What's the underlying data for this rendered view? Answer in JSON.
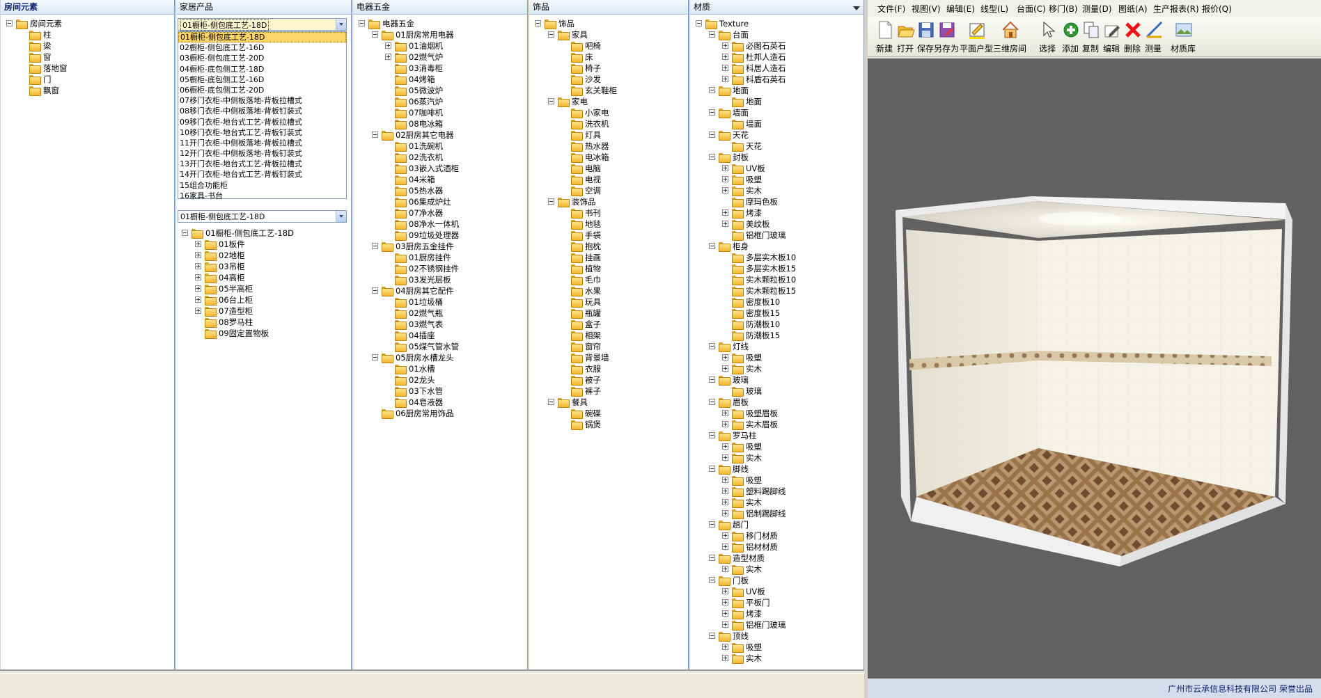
{
  "panels": {
    "room": {
      "title": "房间元素",
      "tree": [
        {
          "label": "房间元素",
          "level": 0,
          "open": true
        },
        {
          "label": "柱",
          "level": 1
        },
        {
          "label": "梁",
          "level": 1
        },
        {
          "label": "窗",
          "level": 1
        },
        {
          "label": "落地窗",
          "level": 1
        },
        {
          "label": "门",
          "level": 1
        },
        {
          "label": "飘窗",
          "level": 1
        }
      ]
    },
    "furniture": {
      "title": "家居产品",
      "dropdown_value": "01橱柜-侧包底工艺-18D",
      "dropdown_options": [
        "01橱柜-侧包底工艺-18D",
        "02橱柜-侧包底工艺-16D",
        "03橱柜-侧包底工艺-20D",
        "04橱柜-底包侧工艺-18D",
        "05橱柜-底包侧工艺-16D",
        "06橱柜-底包侧工艺-20D",
        "07移门衣柜-中侧板落地-背板拉槽式",
        "08移门衣柜-中侧板落地-背板钉装式",
        "09移门衣柜-地台式工艺-背板拉槽式",
        "10移门衣柜-地台式工艺-背板钉装式",
        "11开门衣柜-中侧板落地-背板拉槽式",
        "12开门衣柜-中侧板落地-背板钉装式",
        "13开门衣柜-地台式工艺-背板拉槽式",
        "14开门衣柜-地台式工艺-背板钉装式",
        "15组合功能柜",
        "16家具-书台"
      ],
      "dropdown2_value": "01橱柜-侧包底工艺-18D",
      "tree": [
        {
          "label": "01橱柜-侧包底工艺-18D",
          "level": 0,
          "open": true
        },
        {
          "label": "01板件",
          "level": 1,
          "plus": true
        },
        {
          "label": "02地柜",
          "level": 1,
          "plus": true
        },
        {
          "label": "03吊柜",
          "level": 1,
          "plus": true
        },
        {
          "label": "04高柜",
          "level": 1,
          "plus": true
        },
        {
          "label": "05半高柜",
          "level": 1,
          "plus": true
        },
        {
          "label": "06台上柜",
          "level": 1,
          "plus": true
        },
        {
          "label": "07造型柜",
          "level": 1,
          "plus": true
        },
        {
          "label": "08罗马柱",
          "level": 1
        },
        {
          "label": "09固定置物板",
          "level": 1
        }
      ]
    },
    "appliance": {
      "title": "电器五金",
      "tree": [
        {
          "label": "电器五金",
          "level": 0,
          "open": true
        },
        {
          "label": "01厨房常用电器",
          "level": 1,
          "open": true
        },
        {
          "label": "01油烟机",
          "level": 2,
          "plus": true
        },
        {
          "label": "02燃气炉",
          "level": 2,
          "plus": true
        },
        {
          "label": "03消毒柜",
          "level": 2
        },
        {
          "label": "04烤箱",
          "level": 2
        },
        {
          "label": "05微波炉",
          "level": 2
        },
        {
          "label": "06蒸汽炉",
          "level": 2
        },
        {
          "label": "07咖啡机",
          "level": 2
        },
        {
          "label": "08电冰箱",
          "level": 2
        },
        {
          "label": "02厨房其它电器",
          "level": 1,
          "open": true
        },
        {
          "label": "01洗碗机",
          "level": 2
        },
        {
          "label": "02洗衣机",
          "level": 2
        },
        {
          "label": "03嵌入式酒柜",
          "level": 2
        },
        {
          "label": "04米箱",
          "level": 2
        },
        {
          "label": "05热水器",
          "level": 2
        },
        {
          "label": "06集成炉灶",
          "level": 2
        },
        {
          "label": "07净水器",
          "level": 2
        },
        {
          "label": "08净水一体机",
          "level": 2
        },
        {
          "label": "09垃圾处理器",
          "level": 2
        },
        {
          "label": "03厨房五金挂件",
          "level": 1,
          "open": true
        },
        {
          "label": "01厨房挂件",
          "level": 2
        },
        {
          "label": "02不锈钢挂件",
          "level": 2
        },
        {
          "label": "03发光层板",
          "level": 2
        },
        {
          "label": "04厨房其它配件",
          "level": 1,
          "open": true
        },
        {
          "label": "01垃圾桶",
          "level": 2
        },
        {
          "label": "02燃气瓶",
          "level": 2
        },
        {
          "label": "03燃气表",
          "level": 2
        },
        {
          "label": "04插座",
          "level": 2
        },
        {
          "label": "05煤气管水管",
          "level": 2
        },
        {
          "label": "05厨房水槽龙头",
          "level": 1,
          "open": true
        },
        {
          "label": "01水槽",
          "level": 2
        },
        {
          "label": "02龙头",
          "level": 2
        },
        {
          "label": "03下水管",
          "level": 2
        },
        {
          "label": "04皂液器",
          "level": 2
        },
        {
          "label": "06厨房常用饰品",
          "level": 1
        }
      ]
    },
    "decor": {
      "title": "饰品",
      "tree": [
        {
          "label": "饰品",
          "level": 0,
          "open": true
        },
        {
          "label": "家具",
          "level": 1,
          "open": true
        },
        {
          "label": "吧椅",
          "level": 2
        },
        {
          "label": "床",
          "level": 2
        },
        {
          "label": "椅子",
          "level": 2
        },
        {
          "label": "沙发",
          "level": 2
        },
        {
          "label": "玄关鞋柜",
          "level": 2
        },
        {
          "label": "家电",
          "level": 1,
          "open": true
        },
        {
          "label": "小家电",
          "level": 2
        },
        {
          "label": "洗衣机",
          "level": 2
        },
        {
          "label": "灯具",
          "level": 2
        },
        {
          "label": "热水器",
          "level": 2
        },
        {
          "label": "电冰箱",
          "level": 2
        },
        {
          "label": "电脑",
          "level": 2
        },
        {
          "label": "电视",
          "level": 2
        },
        {
          "label": "空调",
          "level": 2
        },
        {
          "label": "装饰品",
          "level": 1,
          "open": true
        },
        {
          "label": "书刊",
          "level": 2
        },
        {
          "label": "地毯",
          "level": 2
        },
        {
          "label": "手袋",
          "level": 2
        },
        {
          "label": "抱枕",
          "level": 2
        },
        {
          "label": "挂画",
          "level": 2
        },
        {
          "label": "植物",
          "level": 2
        },
        {
          "label": "毛巾",
          "level": 2
        },
        {
          "label": "水果",
          "level": 2
        },
        {
          "label": "玩具",
          "level": 2
        },
        {
          "label": "瓶罐",
          "level": 2
        },
        {
          "label": "盒子",
          "level": 2
        },
        {
          "label": "相架",
          "level": 2
        },
        {
          "label": "窗帘",
          "level": 2
        },
        {
          "label": "背景墙",
          "level": 2
        },
        {
          "label": "衣服",
          "level": 2
        },
        {
          "label": "被子",
          "level": 2
        },
        {
          "label": "裤子",
          "level": 2
        },
        {
          "label": "餐具",
          "level": 1,
          "open": true
        },
        {
          "label": "碗碟",
          "level": 2
        },
        {
          "label": "锅煲",
          "level": 2
        }
      ]
    },
    "material": {
      "title": "材质",
      "tree": [
        {
          "label": "Texture",
          "level": 0,
          "open": true
        },
        {
          "label": "台面",
          "level": 1,
          "open": true
        },
        {
          "label": "必图石英石",
          "level": 2,
          "plus": true
        },
        {
          "label": "杜邦人造石",
          "level": 2,
          "plus": true
        },
        {
          "label": "科居人造石",
          "level": 2,
          "plus": true
        },
        {
          "label": "科盾石英石",
          "level": 2,
          "plus": true
        },
        {
          "label": "地面",
          "level": 1,
          "open": true
        },
        {
          "label": "地面",
          "level": 2
        },
        {
          "label": "墙面",
          "level": 1,
          "open": true
        },
        {
          "label": "墙面",
          "level": 2
        },
        {
          "label": "天花",
          "level": 1,
          "open": true
        },
        {
          "label": "天花",
          "level": 2
        },
        {
          "label": "封板",
          "level": 1,
          "open": true
        },
        {
          "label": "UV板",
          "level": 2,
          "plus": true
        },
        {
          "label": "吸塑",
          "level": 2,
          "plus": true
        },
        {
          "label": "实木",
          "level": 2,
          "plus": true
        },
        {
          "label": "摩玛色板",
          "level": 2
        },
        {
          "label": "烤漆",
          "level": 2,
          "plus": true
        },
        {
          "label": "美纹板",
          "level": 2,
          "plus": true
        },
        {
          "label": "铝框门玻璃",
          "level": 2
        },
        {
          "label": "柜身",
          "level": 1,
          "open": true
        },
        {
          "label": "多层实木板10",
          "level": 2
        },
        {
          "label": "多层实木板15",
          "level": 2
        },
        {
          "label": "实木颗粒板10",
          "level": 2
        },
        {
          "label": "实木颗粒板15",
          "level": 2
        },
        {
          "label": "密度板10",
          "level": 2
        },
        {
          "label": "密度板15",
          "level": 2
        },
        {
          "label": "防潮板10",
          "level": 2
        },
        {
          "label": "防潮板15",
          "level": 2
        },
        {
          "label": "灯线",
          "level": 1,
          "open": true
        },
        {
          "label": "吸塑",
          "level": 2,
          "plus": true
        },
        {
          "label": "实木",
          "level": 2,
          "plus": true
        },
        {
          "label": "玻璃",
          "level": 1,
          "open": true
        },
        {
          "label": "玻璃",
          "level": 2
        },
        {
          "label": "眉板",
          "level": 1,
          "open": true
        },
        {
          "label": "吸塑眉板",
          "level": 2,
          "plus": true
        },
        {
          "label": "实木眉板",
          "level": 2,
          "plus": true
        },
        {
          "label": "罗马柱",
          "level": 1,
          "open": true
        },
        {
          "label": "吸塑",
          "level": 2,
          "plus": true
        },
        {
          "label": "实木",
          "level": 2,
          "plus": true
        },
        {
          "label": "脚线",
          "level": 1,
          "open": true
        },
        {
          "label": "吸塑",
          "level": 2,
          "plus": true
        },
        {
          "label": "塑料踢脚线",
          "level": 2,
          "plus": true
        },
        {
          "label": "实木",
          "level": 2,
          "plus": true
        },
        {
          "label": "铝制踢脚线",
          "level": 2,
          "plus": true
        },
        {
          "label": "趟门",
          "level": 1,
          "open": true
        },
        {
          "label": "移门材质",
          "level": 2,
          "plus": true
        },
        {
          "label": "铝材材质",
          "level": 2,
          "plus": true
        },
        {
          "label": "造型材质",
          "level": 1,
          "open": true
        },
        {
          "label": "实木",
          "level": 2,
          "plus": true
        },
        {
          "label": "门板",
          "level": 1,
          "open": true
        },
        {
          "label": "UV板",
          "level": 2,
          "plus": true
        },
        {
          "label": "平板门",
          "level": 2,
          "plus": true
        },
        {
          "label": "烤漆",
          "level": 2,
          "plus": true
        },
        {
          "label": "铝框门玻璃",
          "level": 2,
          "plus": true
        },
        {
          "label": "顶线",
          "level": 1,
          "open": true
        },
        {
          "label": "吸塑",
          "level": 2,
          "plus": true
        },
        {
          "label": "实木",
          "level": 2,
          "plus": true
        }
      ]
    }
  },
  "menu": [
    "文件(F)",
    "视图(V)",
    "编辑(E)",
    "线型(L)",
    "台面(C)",
    "移门(B)",
    "测量(D)",
    "图纸(A)",
    "生产报表(R)",
    "报价(Q)"
  ],
  "toolbar": [
    {
      "label": "新建",
      "icon": "new-file-icon"
    },
    {
      "label": "打开",
      "icon": "open-folder-icon"
    },
    {
      "label": "保存",
      "icon": "save-icon"
    },
    {
      "label": "另存为",
      "icon": "save-as-icon"
    },
    {
      "label": "平面户型",
      "icon": "floor-plan-icon"
    },
    {
      "label": "三维房间",
      "icon": "house-icon"
    },
    {
      "label": "选择",
      "icon": "cursor-icon"
    },
    {
      "label": "添加",
      "icon": "add-icon"
    },
    {
      "label": "复制",
      "icon": "copy-icon"
    },
    {
      "label": "编辑",
      "icon": "edit-icon"
    },
    {
      "label": "删除",
      "icon": "delete-icon"
    },
    {
      "label": "测量",
      "icon": "measure-icon"
    },
    {
      "label": "材质库",
      "icon": "material-library-icon"
    }
  ],
  "footer": "广州市云承信息科技有限公司 荣誉出品",
  "colors": {
    "accent": "#0a246a",
    "viewport_bg": "#616161",
    "folder": "#f3b830"
  }
}
